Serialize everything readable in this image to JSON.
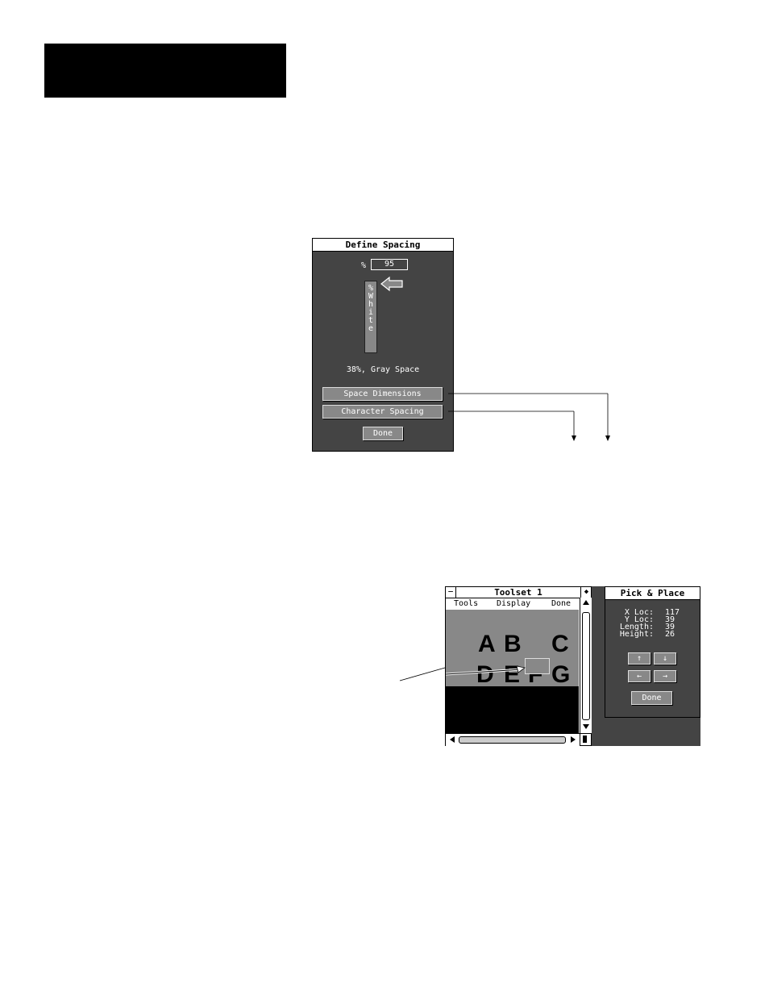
{
  "define_spacing": {
    "title": "Define Spacing",
    "percent_label": "%",
    "percent_value": "95",
    "slider_label": "% White",
    "gray_space": "38%, Gray Space",
    "buttons": {
      "space_dimensions": "Space Dimensions",
      "character_spacing": "Character Spacing",
      "done": "Done"
    }
  },
  "toolset": {
    "title": "Toolset 1",
    "close_glyph": "−",
    "zoom_glyph": "◆",
    "menu": [
      "Tools",
      "Display",
      "Done"
    ],
    "letters_row1": [
      "A",
      "B",
      "C"
    ],
    "letters_row2": [
      "D",
      "E",
      "F",
      "G"
    ]
  },
  "pick_place": {
    "title": "Pick & Place",
    "fields": [
      {
        "label": "X Loc:",
        "value": "117"
      },
      {
        "label": "Y Loc:",
        "value": "39"
      },
      {
        "label": "Length:",
        "value": "39"
      },
      {
        "label": "Height:",
        "value": "26"
      }
    ],
    "arrows": {
      "up": "↑",
      "down": "↓",
      "left": "←",
      "right": "→"
    },
    "done": "Done"
  }
}
